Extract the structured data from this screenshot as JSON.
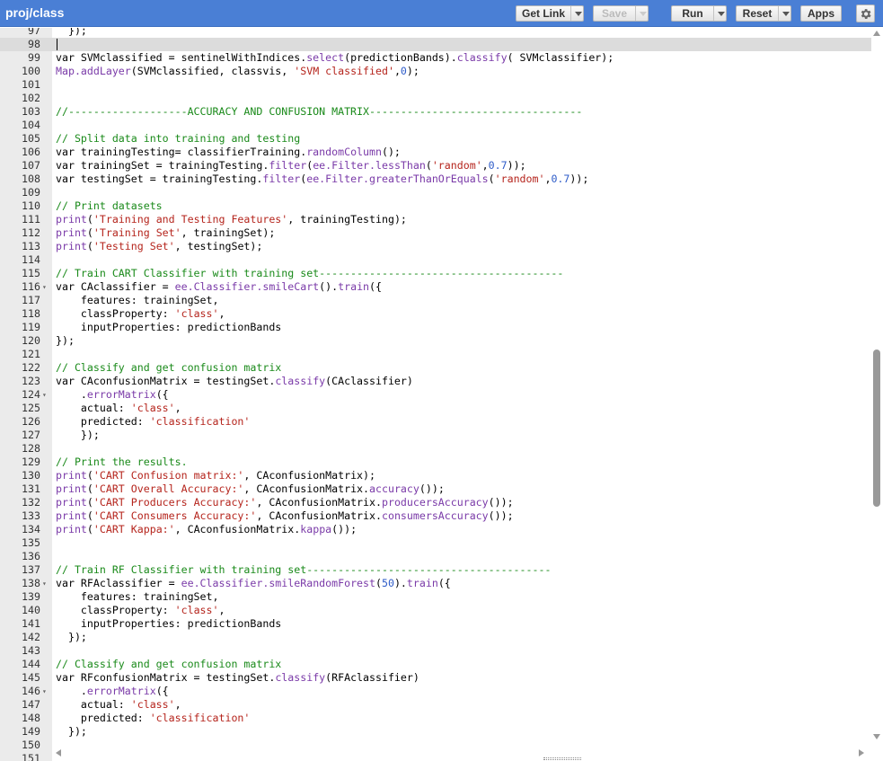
{
  "toolbar": {
    "title": "proj/class",
    "get_link_label": "Get Link",
    "save_label": "Save",
    "run_label": "Run",
    "reset_label": "Reset",
    "apps_label": "Apps",
    "settings_icon": "gear-icon"
  },
  "editor": {
    "current_line": "98",
    "lines": [
      {
        "n": "97",
        "fold": false,
        "tokens": [
          [
            "p",
            "  });"
          ]
        ]
      },
      {
        "n": "98",
        "fold": false,
        "tokens": []
      },
      {
        "n": "99",
        "fold": false,
        "tokens": [
          [
            "p",
            "var SVMclassified = sentinelWithIndices."
          ],
          [
            "f",
            "select"
          ],
          [
            "p",
            "(predictionBands)."
          ],
          [
            "f",
            "classify"
          ],
          [
            "p",
            "( SVMclassifier);"
          ]
        ]
      },
      {
        "n": "100",
        "fold": false,
        "tokens": [
          [
            "f",
            "Map.addLayer"
          ],
          [
            "p",
            "(SVMclassified, classvis, "
          ],
          [
            "s",
            "'SVM classified'"
          ],
          [
            "p",
            ","
          ],
          [
            "n",
            "0"
          ],
          [
            "p",
            ");"
          ]
        ]
      },
      {
        "n": "101",
        "fold": false,
        "tokens": []
      },
      {
        "n": "102",
        "fold": false,
        "tokens": []
      },
      {
        "n": "103",
        "fold": false,
        "tokens": [
          [
            "c",
            "//-------------------ACCURACY AND CONFUSION MATRIX----------------------------------"
          ]
        ]
      },
      {
        "n": "104",
        "fold": false,
        "tokens": []
      },
      {
        "n": "105",
        "fold": false,
        "tokens": [
          [
            "c",
            "// Split data into training and testing"
          ]
        ]
      },
      {
        "n": "106",
        "fold": false,
        "tokens": [
          [
            "p",
            "var trainingTesting= classifierTraining."
          ],
          [
            "f",
            "randomColumn"
          ],
          [
            "p",
            "();"
          ]
        ]
      },
      {
        "n": "107",
        "fold": false,
        "tokens": [
          [
            "p",
            "var trainingSet = trainingTesting."
          ],
          [
            "f",
            "filter"
          ],
          [
            "p",
            "("
          ],
          [
            "f",
            "ee.Filter.lessThan"
          ],
          [
            "p",
            "("
          ],
          [
            "s",
            "'random'"
          ],
          [
            "p",
            ","
          ],
          [
            "n",
            "0.7"
          ],
          [
            "p",
            "));"
          ]
        ]
      },
      {
        "n": "108",
        "fold": false,
        "tokens": [
          [
            "p",
            "var testingSet = trainingTesting."
          ],
          [
            "f",
            "filter"
          ],
          [
            "p",
            "("
          ],
          [
            "f",
            "ee.Filter.greaterThanOrEquals"
          ],
          [
            "p",
            "("
          ],
          [
            "s",
            "'random'"
          ],
          [
            "p",
            ","
          ],
          [
            "n",
            "0.7"
          ],
          [
            "p",
            "));"
          ]
        ]
      },
      {
        "n": "109",
        "fold": false,
        "tokens": []
      },
      {
        "n": "110",
        "fold": false,
        "tokens": [
          [
            "c",
            "// Print datasets"
          ]
        ]
      },
      {
        "n": "111",
        "fold": false,
        "tokens": [
          [
            "f",
            "print"
          ],
          [
            "p",
            "("
          ],
          [
            "s",
            "'Training and Testing Features'"
          ],
          [
            "p",
            ", trainingTesting);"
          ]
        ]
      },
      {
        "n": "112",
        "fold": false,
        "tokens": [
          [
            "f",
            "print"
          ],
          [
            "p",
            "("
          ],
          [
            "s",
            "'Training Set'"
          ],
          [
            "p",
            ", trainingSet);"
          ]
        ]
      },
      {
        "n": "113",
        "fold": false,
        "tokens": [
          [
            "f",
            "print"
          ],
          [
            "p",
            "("
          ],
          [
            "s",
            "'Testing Set'"
          ],
          [
            "p",
            ", testingSet);"
          ]
        ]
      },
      {
        "n": "114",
        "fold": false,
        "tokens": []
      },
      {
        "n": "115",
        "fold": false,
        "tokens": [
          [
            "c",
            "// Train CART Classifier with training set---------------------------------------"
          ]
        ]
      },
      {
        "n": "116",
        "fold": true,
        "tokens": [
          [
            "p",
            "var CAclassifier = "
          ],
          [
            "f",
            "ee.Classifier.smileCart"
          ],
          [
            "p",
            "()."
          ],
          [
            "f",
            "train"
          ],
          [
            "p",
            "({"
          ]
        ]
      },
      {
        "n": "117",
        "fold": false,
        "tokens": [
          [
            "p",
            "    features: trainingSet,"
          ]
        ]
      },
      {
        "n": "118",
        "fold": false,
        "tokens": [
          [
            "p",
            "    classProperty: "
          ],
          [
            "s",
            "'class'"
          ],
          [
            "p",
            ","
          ]
        ]
      },
      {
        "n": "119",
        "fold": false,
        "tokens": [
          [
            "p",
            "    inputProperties: predictionBands"
          ]
        ]
      },
      {
        "n": "120",
        "fold": false,
        "tokens": [
          [
            "p",
            "});"
          ]
        ]
      },
      {
        "n": "121",
        "fold": false,
        "tokens": []
      },
      {
        "n": "122",
        "fold": false,
        "tokens": [
          [
            "c",
            "// Classify and get confusion matrix"
          ]
        ]
      },
      {
        "n": "123",
        "fold": false,
        "tokens": [
          [
            "p",
            "var CAconfusionMatrix = testingSet."
          ],
          [
            "f",
            "classify"
          ],
          [
            "p",
            "(CAclassifier)"
          ]
        ]
      },
      {
        "n": "124",
        "fold": true,
        "tokens": [
          [
            "p",
            "    ."
          ],
          [
            "f",
            "errorMatrix"
          ],
          [
            "p",
            "({"
          ]
        ]
      },
      {
        "n": "125",
        "fold": false,
        "tokens": [
          [
            "p",
            "    actual: "
          ],
          [
            "s",
            "'class'"
          ],
          [
            "p",
            ","
          ]
        ]
      },
      {
        "n": "126",
        "fold": false,
        "tokens": [
          [
            "p",
            "    predicted: "
          ],
          [
            "s",
            "'classification'"
          ]
        ]
      },
      {
        "n": "127",
        "fold": false,
        "tokens": [
          [
            "p",
            "    });"
          ]
        ]
      },
      {
        "n": "128",
        "fold": false,
        "tokens": []
      },
      {
        "n": "129",
        "fold": false,
        "tokens": [
          [
            "c",
            "// Print the results."
          ]
        ]
      },
      {
        "n": "130",
        "fold": false,
        "tokens": [
          [
            "f",
            "print"
          ],
          [
            "p",
            "("
          ],
          [
            "s",
            "'CART Confusion matrix:'"
          ],
          [
            "p",
            ", CAconfusionMatrix);"
          ]
        ]
      },
      {
        "n": "131",
        "fold": false,
        "tokens": [
          [
            "f",
            "print"
          ],
          [
            "p",
            "("
          ],
          [
            "s",
            "'CART Overall Accuracy:'"
          ],
          [
            "p",
            ", CAconfusionMatrix."
          ],
          [
            "f",
            "accuracy"
          ],
          [
            "p",
            "());"
          ]
        ]
      },
      {
        "n": "132",
        "fold": false,
        "tokens": [
          [
            "f",
            "print"
          ],
          [
            "p",
            "("
          ],
          [
            "s",
            "'CART Producers Accuracy:'"
          ],
          [
            "p",
            ", CAconfusionMatrix."
          ],
          [
            "f",
            "producersAccuracy"
          ],
          [
            "p",
            "());"
          ]
        ]
      },
      {
        "n": "133",
        "fold": false,
        "tokens": [
          [
            "f",
            "print"
          ],
          [
            "p",
            "("
          ],
          [
            "s",
            "'CART Consumers Accuracy:'"
          ],
          [
            "p",
            ", CAconfusionMatrix."
          ],
          [
            "f",
            "consumersAccuracy"
          ],
          [
            "p",
            "());"
          ]
        ]
      },
      {
        "n": "134",
        "fold": false,
        "tokens": [
          [
            "f",
            "print"
          ],
          [
            "p",
            "("
          ],
          [
            "s",
            "'CART Kappa:'"
          ],
          [
            "p",
            ", CAconfusionMatrix."
          ],
          [
            "f",
            "kappa"
          ],
          [
            "p",
            "());"
          ]
        ]
      },
      {
        "n": "135",
        "fold": false,
        "tokens": []
      },
      {
        "n": "136",
        "fold": false,
        "tokens": []
      },
      {
        "n": "137",
        "fold": false,
        "tokens": [
          [
            "c",
            "// Train RF Classifier with training set---------------------------------------"
          ]
        ]
      },
      {
        "n": "138",
        "fold": true,
        "tokens": [
          [
            "p",
            "var RFAclassifier = "
          ],
          [
            "f",
            "ee.Classifier.smileRandomForest"
          ],
          [
            "p",
            "("
          ],
          [
            "n",
            "50"
          ],
          [
            "p",
            ")."
          ],
          [
            "f",
            "train"
          ],
          [
            "p",
            "({"
          ]
        ]
      },
      {
        "n": "139",
        "fold": false,
        "tokens": [
          [
            "p",
            "    features: trainingSet,"
          ]
        ]
      },
      {
        "n": "140",
        "fold": false,
        "tokens": [
          [
            "p",
            "    classProperty: "
          ],
          [
            "s",
            "'class'"
          ],
          [
            "p",
            ","
          ]
        ]
      },
      {
        "n": "141",
        "fold": false,
        "tokens": [
          [
            "p",
            "    inputProperties: predictionBands"
          ]
        ]
      },
      {
        "n": "142",
        "fold": false,
        "tokens": [
          [
            "p",
            "  });"
          ]
        ]
      },
      {
        "n": "143",
        "fold": false,
        "tokens": []
      },
      {
        "n": "144",
        "fold": false,
        "tokens": [
          [
            "c",
            "// Classify and get confusion matrix"
          ]
        ]
      },
      {
        "n": "145",
        "fold": false,
        "tokens": [
          [
            "p",
            "var RFconfusionMatrix = testingSet."
          ],
          [
            "f",
            "classify"
          ],
          [
            "p",
            "(RFAclassifier)"
          ]
        ]
      },
      {
        "n": "146",
        "fold": true,
        "tokens": [
          [
            "p",
            "    ."
          ],
          [
            "f",
            "errorMatrix"
          ],
          [
            "p",
            "({"
          ]
        ]
      },
      {
        "n": "147",
        "fold": false,
        "tokens": [
          [
            "p",
            "    actual: "
          ],
          [
            "s",
            "'class'"
          ],
          [
            "p",
            ","
          ]
        ]
      },
      {
        "n": "148",
        "fold": false,
        "tokens": [
          [
            "p",
            "    predicted: "
          ],
          [
            "s",
            "'classification'"
          ]
        ]
      },
      {
        "n": "149",
        "fold": false,
        "tokens": [
          [
            "p",
            "  });"
          ]
        ]
      },
      {
        "n": "150",
        "fold": false,
        "tokens": []
      },
      {
        "n": "151",
        "fold": false,
        "tokens": []
      }
    ]
  },
  "colors": {
    "toolbar_bg": "#4a7fd5",
    "comment": "#1a8a1a",
    "string": "#b5241c",
    "number": "#2d5bc8",
    "function": "#7a3aa8"
  }
}
